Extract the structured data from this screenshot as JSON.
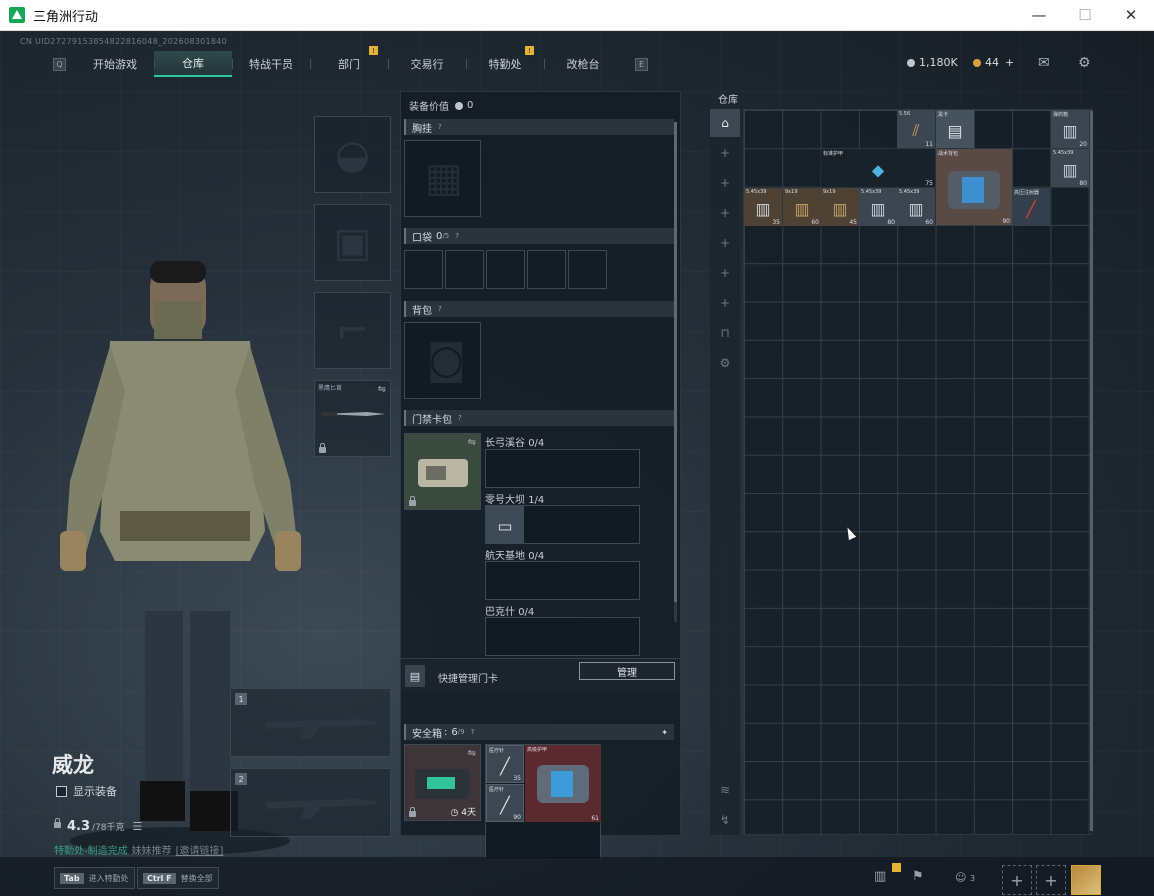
{
  "window": {
    "title": "三角洲行动",
    "minimize": "—",
    "maximize": "☐",
    "close": "✕"
  },
  "uid": "CN UID2727915385482281604​8_202608301840",
  "nav": {
    "left_key": "Q",
    "right_key": "E",
    "tabs": [
      {
        "label": "开始游戏",
        "active": false,
        "badge": ""
      },
      {
        "label": "仓库",
        "active": true,
        "badge": ""
      },
      {
        "label": "特战干员",
        "active": false,
        "badge": ""
      },
      {
        "label": "部门",
        "active": false,
        "badge": "!"
      },
      {
        "label": "交易行",
        "active": false,
        "badge": ""
      },
      {
        "label": "特勤处",
        "active": false,
        "badge": "!"
      },
      {
        "label": "改枪台",
        "active": false,
        "badge": ""
      }
    ]
  },
  "currency": {
    "coins": "1,180K",
    "gems": "44",
    "add": "+"
  },
  "character": {
    "name": "威龙",
    "show_gear_label": "显示装备",
    "weight_value": "4.3",
    "weight_max": "/78千克",
    "hint_text": "特勤处-制造完成",
    "hint_extra": "妹妹推荐",
    "hint_link": "[邀请链接]"
  },
  "gear": {
    "knife_label": "黑鹰匕首",
    "weapon1_num": "1",
    "weapon2_num": "2"
  },
  "equipment": {
    "value_label": "装备价值",
    "value": "0",
    "chest_rig": "胸挂",
    "pockets": "口袋",
    "pockets_count": "0",
    "pockets_max": "/5",
    "backpack": "背包",
    "keycard_pack": "门禁卡包",
    "key_groups": [
      {
        "label": "长弓溪谷",
        "count": "0/4"
      },
      {
        "label": "零号大坝",
        "count": "1/4"
      },
      {
        "label": "航天基地",
        "count": "0/4"
      },
      {
        "label": "巴克什",
        "count": "0/4"
      }
    ],
    "quick_manage_label": "快捷管理门卡",
    "manage_button": "管理",
    "safebox_label": "安全箱",
    "safebox_count": "6",
    "safebox_max": "/9",
    "safebox_time": "4天",
    "safebox_items": [
      {
        "name": "医疗针",
        "count": "35"
      },
      {
        "name": "医疗针",
        "count": "90"
      },
      {
        "name": "高级护甲",
        "count": "61"
      }
    ]
  },
  "warehouse": {
    "label": "仓库",
    "items": [
      {
        "name": "5.56",
        "count": "11"
      },
      {
        "name": "黑卡",
        "count": ""
      },
      {
        "name": "弹药箱",
        "count": "20"
      },
      {
        "name": "标准护甲",
        "count": "75"
      },
      {
        "name": "战术背包",
        "count": "90"
      },
      {
        "name": "5.45x39",
        "count": "80"
      },
      {
        "name": "5.45x39",
        "count": "35"
      },
      {
        "name": "9x19",
        "count": "60"
      },
      {
        "name": "9x19",
        "count": "45"
      },
      {
        "name": "5.45x39",
        "count": "80"
      },
      {
        "name": "5.45x39",
        "count": "60"
      },
      {
        "name": "高压注射器",
        "count": ""
      }
    ]
  },
  "bottom": {
    "key1": "Tab",
    "key1_label": "进入特勤处",
    "key2": "Ctrl F",
    "key2_label": "替换全部",
    "friends": "3",
    "add": "+"
  }
}
